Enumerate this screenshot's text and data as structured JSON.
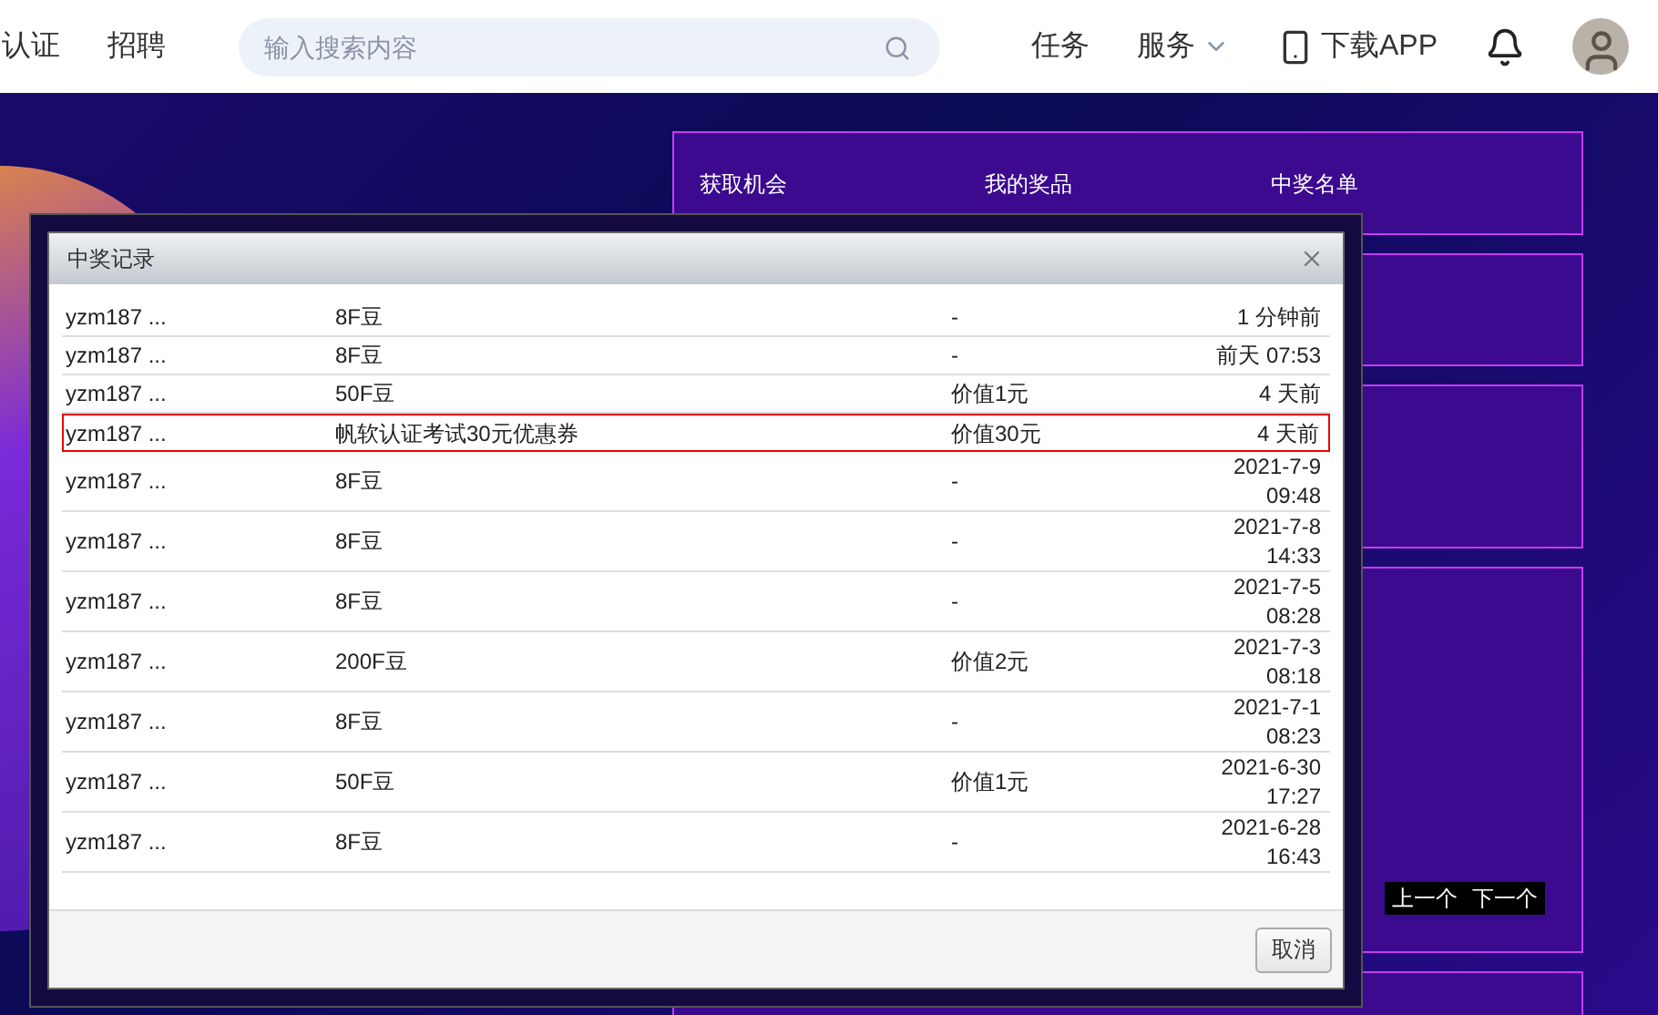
{
  "header": {
    "nav": [
      {
        "label": "认证"
      },
      {
        "label": "招聘"
      }
    ],
    "search": {
      "placeholder": "输入搜索内容"
    },
    "actions": [
      {
        "kind": "text",
        "label": "任务"
      },
      {
        "kind": "menu",
        "label": "服务"
      },
      {
        "kind": "app",
        "label": "下载APP"
      },
      {
        "kind": "bell"
      },
      {
        "kind": "avatar"
      }
    ]
  },
  "panel": {
    "tabs": [
      {
        "label": "获取机会"
      },
      {
        "label": "我的奖品"
      },
      {
        "label": "中奖名单"
      }
    ],
    "pager": [
      "上一个",
      "下一个"
    ]
  },
  "dialog": {
    "title": "中奖记录",
    "rows": [
      {
        "user": "yzm187 ...",
        "prize": "8F豆",
        "value": "-",
        "time": [
          "1 分钟前"
        ],
        "selected": false
      },
      {
        "user": "yzm187 ...",
        "prize": "8F豆",
        "value": "-",
        "time": [
          "前天 07:53"
        ],
        "selected": false
      },
      {
        "user": "yzm187 ...",
        "prize": "50F豆",
        "value": "价值1元",
        "time": [
          "4 天前"
        ],
        "selected": false
      },
      {
        "user": "yzm187 ...",
        "prize": "帆软认证考试30元优惠券",
        "value": "价值30元",
        "time": [
          "4 天前"
        ],
        "selected": true
      },
      {
        "user": "yzm187 ...",
        "prize": "8F豆",
        "value": "-",
        "time": [
          "2021-7-9",
          "09:48"
        ],
        "selected": false
      },
      {
        "user": "yzm187 ...",
        "prize": "8F豆",
        "value": "-",
        "time": [
          "2021-7-8",
          "14:33"
        ],
        "selected": false
      },
      {
        "user": "yzm187 ...",
        "prize": "8F豆",
        "value": "-",
        "time": [
          "2021-7-5",
          "08:28"
        ],
        "selected": false
      },
      {
        "user": "yzm187 ...",
        "prize": "200F豆",
        "value": "价值2元",
        "time": [
          "2021-7-3",
          "08:18"
        ],
        "selected": false
      },
      {
        "user": "yzm187 ...",
        "prize": "8F豆",
        "value": "-",
        "time": [
          "2021-7-1",
          "08:23"
        ],
        "selected": false
      },
      {
        "user": "yzm187 ...",
        "prize": "50F豆",
        "value": "价值1元",
        "time": [
          "2021-6-30",
          "17:27"
        ],
        "selected": false
      },
      {
        "user": "yzm187 ...",
        "prize": "8F豆",
        "value": "-",
        "time": [
          "2021-6-28",
          "16:43"
        ],
        "selected": false
      }
    ],
    "cancel": "取消"
  }
}
